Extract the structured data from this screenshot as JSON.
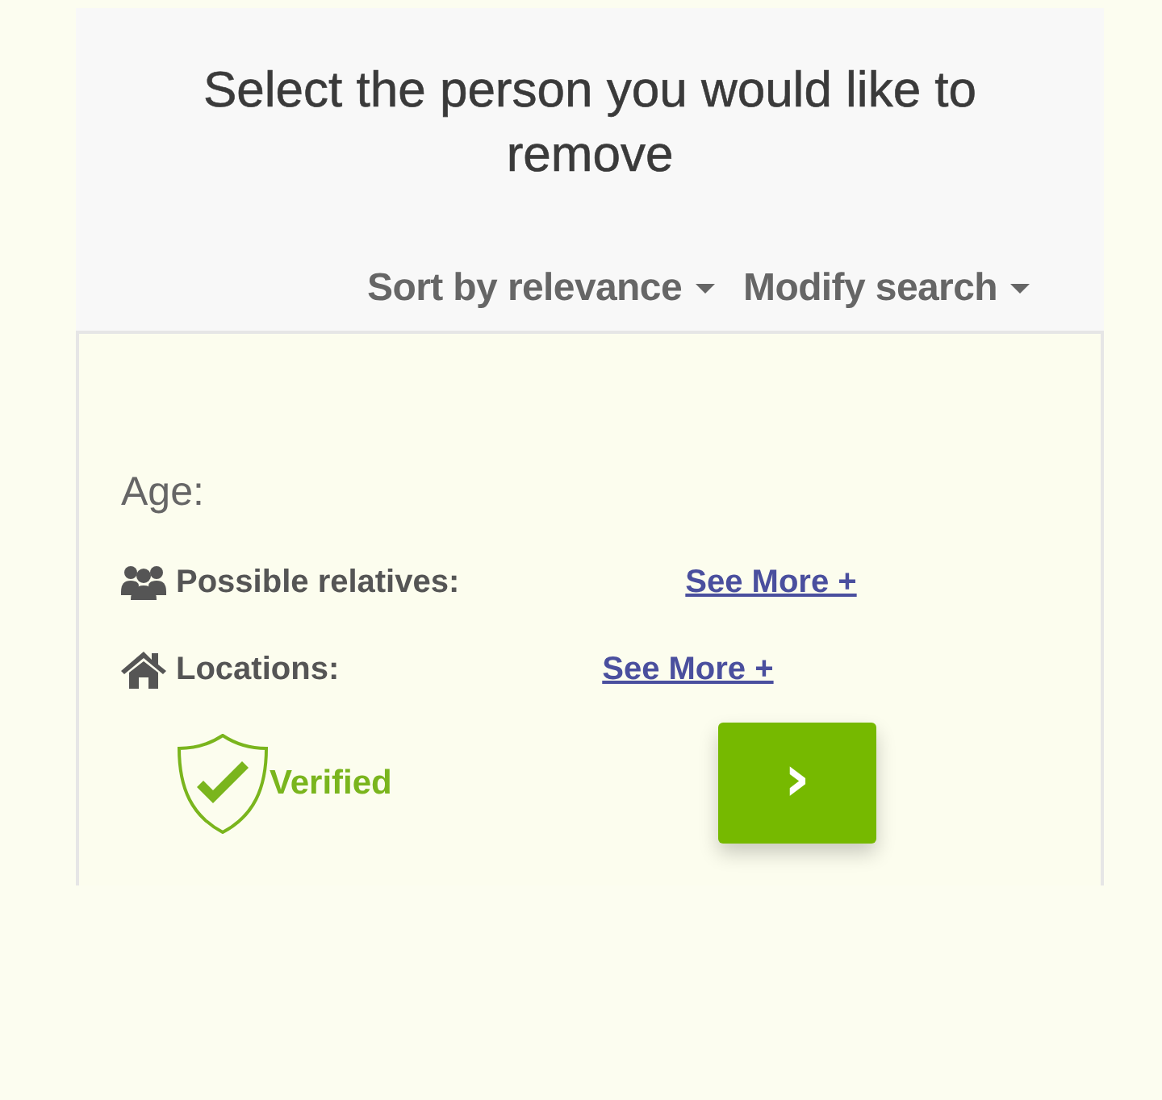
{
  "header": {
    "title": "Select the person you would like to remove",
    "controls": [
      {
        "label": "Sort by relevance"
      },
      {
        "label": "Modify search"
      }
    ]
  },
  "result": {
    "age_label": "Age:",
    "rows": [
      {
        "kind": "relatives",
        "label": "Possible relatives:",
        "link": "See More +"
      },
      {
        "kind": "locations",
        "label": "Locations:",
        "link": "See More +"
      }
    ],
    "badge": "Verified",
    "next_button": "›"
  }
}
